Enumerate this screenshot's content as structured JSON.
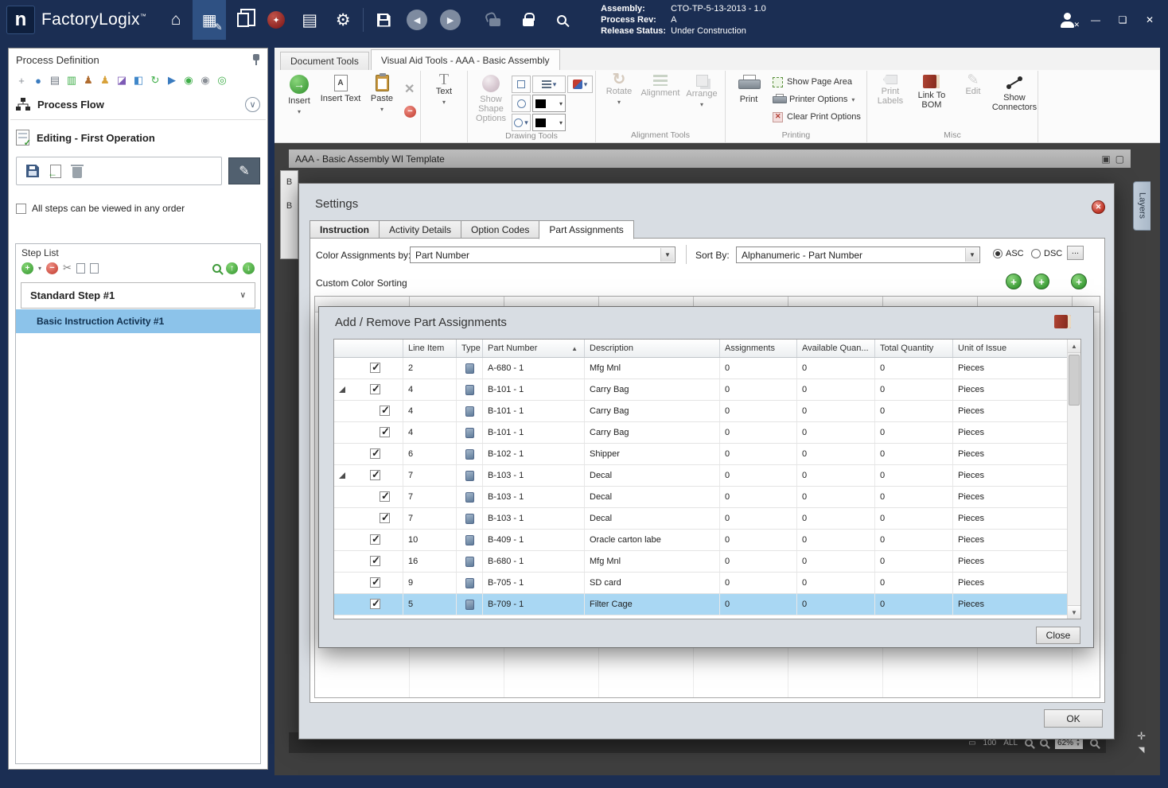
{
  "titlebar": {
    "logo": "n",
    "app_name": "FactoryLogix",
    "trademark": "™",
    "assembly_label": "Assembly:",
    "assembly_value": "CTO-TP-5-13-2013 - 1.0",
    "process_rev_label": "Process Rev:",
    "process_rev_value": "A",
    "release_label": "Release Status:",
    "release_value": "Under Construction",
    "minimize": "—",
    "maximize": "❏",
    "close": "✕"
  },
  "left_panel": {
    "title": "Process Definition",
    "toolbar_icons": [
      {
        "name": "add",
        "glyph": "+",
        "color": "#8a8f96"
      },
      {
        "name": "web",
        "glyph": "●",
        "color": "#3a7bbf"
      },
      {
        "name": "print",
        "glyph": "▤",
        "color": "#6e7680"
      },
      {
        "name": "report",
        "glyph": "▥",
        "color": "#3fae49"
      },
      {
        "name": "user-builder",
        "glyph": "♟",
        "color": "#b06c2f"
      },
      {
        "name": "user",
        "glyph": "♟",
        "color": "#d8a23a"
      },
      {
        "name": "palette",
        "glyph": "◪",
        "color": "#7d5ab5"
      },
      {
        "name": "flow-template",
        "glyph": "◧",
        "color": "#3f87c9"
      },
      {
        "name": "refresh",
        "glyph": "↻",
        "color": "#3fae49"
      },
      {
        "name": "run",
        "glyph": "▶",
        "color": "#3a7bbf"
      },
      {
        "name": "status-green",
        "glyph": "◉",
        "color": "#3fae49"
      },
      {
        "name": "status-gray",
        "glyph": "◉",
        "color": "#8a8f96"
      },
      {
        "name": "status-go",
        "glyph": "◎",
        "color": "#3fae49"
      }
    ],
    "process_flow": "Process Flow",
    "editing_title": "Editing - First Operation",
    "any_order_label": "All steps can be viewed in any order",
    "step_list_title": "Step List",
    "step_name": "Standard Step #1",
    "activity_name": "Basic Instruction Activity #1"
  },
  "ribbon": {
    "tabs": [
      {
        "label": "Document Tools"
      },
      {
        "label": "Visual Aid Tools - AAA - Basic Assembly"
      }
    ],
    "insert": "Insert",
    "insert_text": "Insert Text",
    "paste": "Paste",
    "text": "Text",
    "show_shape_options": "Show Shape Options",
    "drawing_tools": "Drawing Tools",
    "rotate": "Rotate",
    "alignment": "Alignment",
    "arrange": "Arrange",
    "alignment_tools": "Alignment Tools",
    "print": "Print",
    "show_page_area": "Show Page Area",
    "printer_options": "Printer Options",
    "clear_print_options": "Clear Print Options",
    "printing": "Printing",
    "print_labels": "Print Labels",
    "link_to_bom": "Link To BOM",
    "edit": "Edit",
    "show_connectors": "Show Connectors",
    "misc": "Misc"
  },
  "document": {
    "title": "AAA - Basic Assembly WI Template",
    "layers_tab": "Layers",
    "peek": [
      "B",
      "B"
    ]
  },
  "statusbar": {
    "hundred": "100",
    "all": "ALL",
    "zoom": "62%"
  },
  "settings": {
    "title": "Settings",
    "tabs": [
      "Instruction",
      "Activity Details",
      "Option Codes",
      "Part Assignments"
    ],
    "color_by_label": "Color Assignments by:",
    "color_by_value": "Part Number",
    "sort_by_label": "Sort By:",
    "sort_by_value": "Alphanumeric - Part Number",
    "asc": "ASC",
    "dsc": "DSC",
    "more": "...",
    "custom_color_sorting": "Custom Color Sorting",
    "ok": "OK"
  },
  "part_dialog": {
    "title": "Add / Remove Part Assignments",
    "columns": [
      "Line Item",
      "Type",
      "Part Number",
      "Description",
      "Assignments",
      "Available Quan...",
      "Total Quantity",
      "Unit of Issue"
    ],
    "sorted_column": "Part Number",
    "close": "Close",
    "rows": [
      {
        "level": 0,
        "expander": false,
        "checked": true,
        "line": "2",
        "part": "A-680 - 1",
        "desc": "Mfg Mnl",
        "assignments": "0",
        "available": "0",
        "total": "0",
        "unit": "Pieces",
        "selected": false
      },
      {
        "level": 0,
        "expander": true,
        "checked": true,
        "line": "4",
        "part": "B-101 - 1",
        "desc": "Carry Bag",
        "assignments": "0",
        "available": "0",
        "total": "0",
        "unit": "Pieces",
        "selected": false
      },
      {
        "level": 1,
        "expander": false,
        "checked": true,
        "line": "4",
        "part": "B-101 - 1",
        "desc": "Carry Bag",
        "assignments": "0",
        "available": "0",
        "total": "0",
        "unit": "Pieces",
        "selected": false
      },
      {
        "level": 1,
        "expander": false,
        "checked": true,
        "line": "4",
        "part": "B-101 - 1",
        "desc": "Carry Bag",
        "assignments": "0",
        "available": "0",
        "total": "0",
        "unit": "Pieces",
        "selected": false
      },
      {
        "level": 0,
        "expander": false,
        "checked": true,
        "line": "6",
        "part": "B-102 - 1",
        "desc": "Shipper",
        "assignments": "0",
        "available": "0",
        "total": "0",
        "unit": "Pieces",
        "selected": false
      },
      {
        "level": 0,
        "expander": true,
        "checked": true,
        "line": "7",
        "part": "B-103 - 1",
        "desc": "Decal",
        "assignments": "0",
        "available": "0",
        "total": "0",
        "unit": "Pieces",
        "selected": false
      },
      {
        "level": 1,
        "expander": false,
        "checked": true,
        "line": "7",
        "part": "B-103 - 1",
        "desc": "Decal",
        "assignments": "0",
        "available": "0",
        "total": "0",
        "unit": "Pieces",
        "selected": false
      },
      {
        "level": 1,
        "expander": false,
        "checked": true,
        "line": "7",
        "part": "B-103 - 1",
        "desc": "Decal",
        "assignments": "0",
        "available": "0",
        "total": "0",
        "unit": "Pieces",
        "selected": false
      },
      {
        "level": 0,
        "expander": false,
        "checked": true,
        "line": "10",
        "part": "B-409 - 1",
        "desc": "Oracle carton labe",
        "assignments": "0",
        "available": "0",
        "total": "0",
        "unit": "Pieces",
        "selected": false
      },
      {
        "level": 0,
        "expander": false,
        "checked": true,
        "line": "16",
        "part": "B-680 - 1",
        "desc": "Mfg Mnl",
        "assignments": "0",
        "available": "0",
        "total": "0",
        "unit": "Pieces",
        "selected": false
      },
      {
        "level": 0,
        "expander": false,
        "checked": true,
        "line": "9",
        "part": "B-705 - 1",
        "desc": "SD card",
        "assignments": "0",
        "available": "0",
        "total": "0",
        "unit": "Pieces",
        "selected": false
      },
      {
        "level": 0,
        "expander": false,
        "checked": true,
        "line": "5",
        "part": "B-709 - 1",
        "desc": "Filter Cage",
        "assignments": "0",
        "available": "0",
        "total": "0",
        "unit": "Pieces",
        "selected": true
      }
    ]
  }
}
